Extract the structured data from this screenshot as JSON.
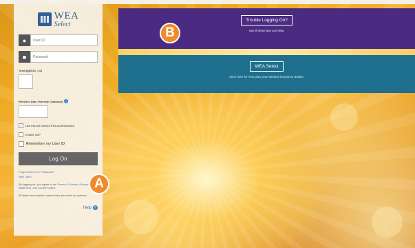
{
  "logo": {
    "wea": "WEA",
    "select": "Select"
  },
  "login": {
    "user_id_placeholder": "User ID",
    "password_placeholder": "Password",
    "test_cfg_label": "TestCfg[6034_1.0]",
    "effective_date_label": "Effective Date Override (Optional)",
    "rsa_label": "Use this site without RSA Authentication.",
    "udp_label": "Enable UDP",
    "remember_label": "Remember my User ID",
    "logon_label": "Log On",
    "forgot_link": "Forgot User ID or Password?",
    "new_user_link": "New User?",
    "agree_prefix": "By logging on, you agree to the",
    "agree_terms": "Terms of Service, Privacy Statement, and Cookie Notice.",
    "required_note": "All fields are required, unless they are noted as optional.",
    "help_label": "Help"
  },
  "banners": {
    "trouble_button": "Trouble Logging On?",
    "trouble_sub": "See if these tips can help.",
    "wea_button": "WEA Select",
    "wea_sub": "Click here for new plan year Medical insurance details."
  },
  "markers": {
    "a": "A",
    "b": "B"
  },
  "colors": {
    "purple": "#4b2b82",
    "teal": "#1e6f8e",
    "marker": "#f08a2c",
    "link": "#3b73b8"
  },
  "icons": {
    "user": "user-icon",
    "lock": "lock-icon",
    "help": "help-icon"
  }
}
